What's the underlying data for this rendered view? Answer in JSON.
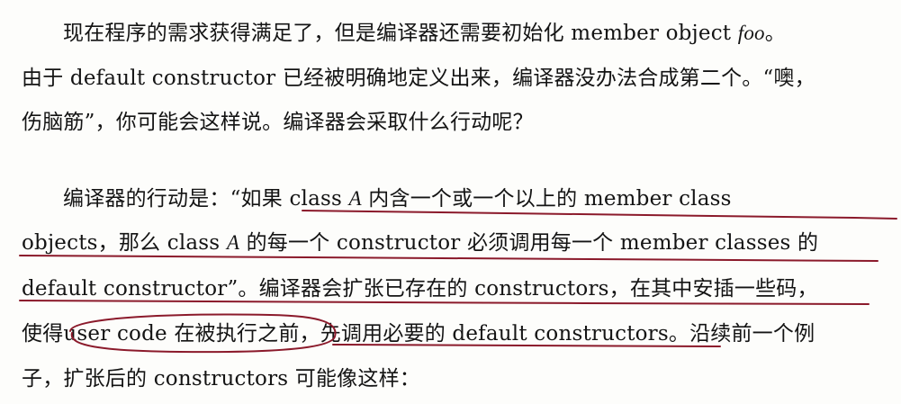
{
  "paragraph1": {
    "line1": {
      "before": "现在程序的需求获得满足了，但是编译器还需要初始化 member object ",
      "foo": "foo",
      "after": "。"
    },
    "line2": "由于 default constructor 已经被明确地定义出来，编译器没办法合成第二个。“噢，",
    "line3": "伤脑筋”，你可能会这样说。编译器会采取什么行动呢？"
  },
  "paragraph2": {
    "line1": {
      "before": "编译器的行动是：“如果 class ",
      "a": "A",
      "after": " 内含一个或一个以上的 member class"
    },
    "line2": {
      "before": "objects，那么 class ",
      "a": "A",
      "after": " 的每一个 constructor 必须调用每一个 member classes 的"
    },
    "line3": "default constructor”。编译器会扩张已存在的 constructors，在其中安插一些码，",
    "line4": {
      "pre": "使得",
      "circled": "user code 在被执行之前，",
      "post": "先调用必要的 default constructors。沿续前一个例"
    },
    "line5": "子，扩张后的 constructors 可能像这样："
  },
  "annotations": {
    "ink_color": "#8b1a2b"
  }
}
